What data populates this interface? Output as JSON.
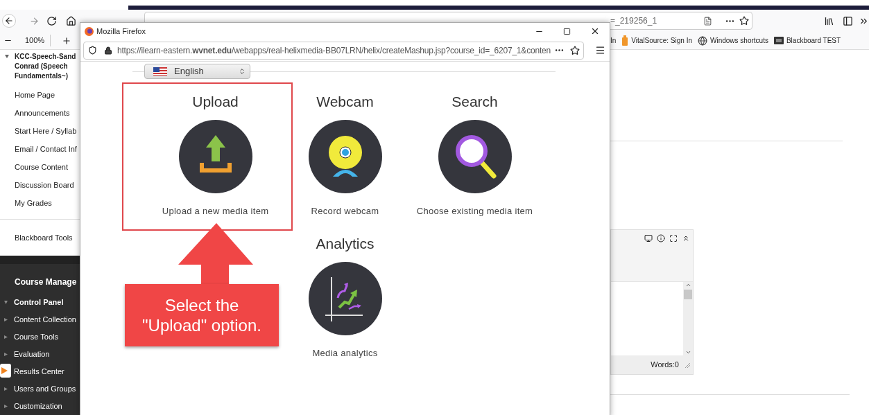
{
  "browser": {
    "url_tail": "=_219256_1",
    "zoom": "100%",
    "bookmarks": [
      {
        "label": "In",
        "kind": "plain"
      },
      {
        "label": "VitalSource: Sign In",
        "kind": "tag"
      },
      {
        "label": "Windows shortcuts",
        "kind": "globe"
      },
      {
        "label": "Blackboard TEST",
        "kind": "board"
      }
    ]
  },
  "sidebar": {
    "course_title": "KCC-Speech-Sand\nConrad (Speech\nFundamentals~)",
    "items": [
      "Home Page",
      "Announcements",
      "Start Here / Syllab",
      "Email / Contact Inf",
      "Course Content",
      "Discussion Board",
      "My Grades"
    ],
    "tools": "Blackboard Tools",
    "management_title": "Course Manage",
    "management_items": [
      {
        "label": "Control Panel",
        "expanded": true
      },
      {
        "label": "Content Collection",
        "expanded": false
      },
      {
        "label": "Course Tools",
        "expanded": false
      },
      {
        "label": "Evaluation",
        "expanded": false
      },
      {
        "label": "Results Center"
      },
      {
        "label": "Users and Groups",
        "expanded": false
      },
      {
        "label": "Customization",
        "expanded": false
      }
    ]
  },
  "editor": {
    "word_count": "Words:0"
  },
  "popup": {
    "title": "Mozilla Firefox",
    "url": "https://ilearn-eastern.**wvnet.edu**/webapps/real-helixmedia-BB07LRN/helix/createMashup.jsp?course_id=_6207_1&conten",
    "language": "English",
    "options": [
      {
        "kind": "upload",
        "title": "Upload",
        "caption": "Upload a new media item",
        "highlighted": true
      },
      {
        "kind": "webcam",
        "title": "Webcam",
        "caption": "Record webcam",
        "highlighted": false
      },
      {
        "kind": "search",
        "title": "Search",
        "caption": "Choose existing media item",
        "highlighted": false
      },
      {
        "kind": "analytics",
        "title": "Analytics",
        "caption": "Media analytics",
        "highlighted": false
      }
    ]
  },
  "callout": {
    "text": "Select the\n\"Upload\" option."
  }
}
